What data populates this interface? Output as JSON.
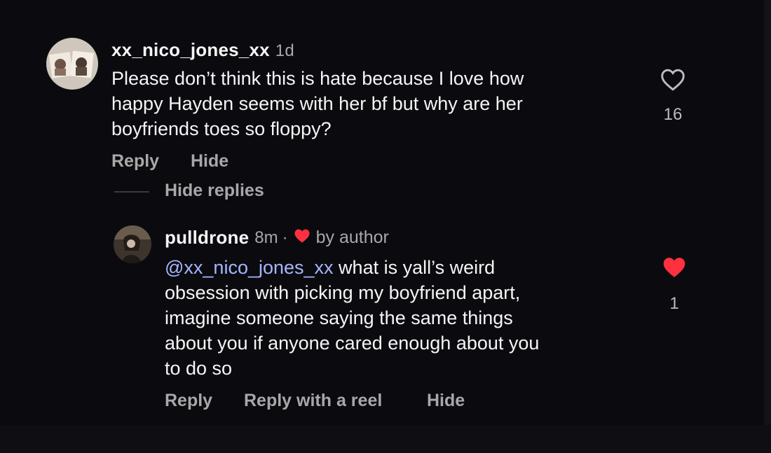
{
  "comment": {
    "username": "xx_nico_jones_xx",
    "time": "1d",
    "text": "Please don’t think this is hate because I love how\nhappy Hayden seems with her bf but why are her\nboyfriends toes so floppy?",
    "likes": "16",
    "liked": false,
    "actions": {
      "reply": "Reply",
      "hide": "Hide"
    },
    "hide_replies": "Hide replies"
  },
  "reply": {
    "username": "pulldrone",
    "time": "8m",
    "separator": "·",
    "badge": "by author",
    "mention": "@xx_nico_jones_xx",
    "text": " what is yall’s weird\nobsession with picking my boyfriend apart,\nimagine someone saying the same things\nabout you if anyone cared enough about you\nto do so",
    "likes": "1",
    "liked": true,
    "actions": {
      "reply": "Reply",
      "reply_with_reel": "Reply with a reel",
      "hide": "Hide"
    }
  },
  "colors": {
    "background": "#0b0b0f",
    "text": "#f5f5f5",
    "secondary": "#a8a8a8",
    "mention": "#a7b5ff",
    "liked_heart": "#ff3040"
  },
  "icons": {
    "comment_like": "heart-outline-icon",
    "reply_like": "heart-filled-icon",
    "author_badge": "heart-filled-icon"
  }
}
